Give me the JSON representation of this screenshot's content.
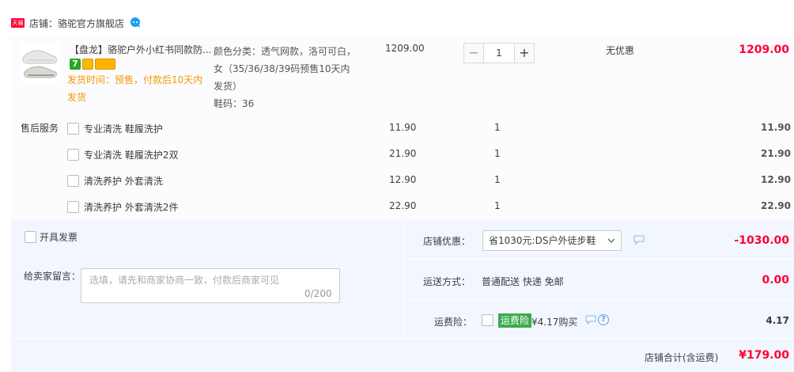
{
  "store": {
    "badge": "天猫",
    "label": "店铺：骆驼官方旗舰店"
  },
  "item": {
    "title": "【盘龙】骆驼户外小红书同款防...",
    "service_icons": [
      "7",
      "bag-icon",
      "card-icon"
    ],
    "ship_note": "发货时间：预售，付款后10天内发货",
    "attrs": [
      "颜色分类：透气网款，洛可可白，",
      "女（35/36/38/39码预售10天内",
      "发货）",
      "鞋码：36"
    ],
    "unit_price": "1209.00",
    "quantity": "1",
    "promotion": "无优惠",
    "total": "1209.00"
  },
  "after_sales": {
    "label": "售后服务",
    "rows": [
      {
        "name": "专业清洗 鞋履洗护",
        "price": "11.90",
        "count": "1",
        "sum": "11.90"
      },
      {
        "name": "专业清洗 鞋履洗护2双",
        "price": "21.90",
        "count": "1",
        "sum": "21.90"
      },
      {
        "name": "清洗养护 外套清洗",
        "price": "12.90",
        "count": "1",
        "sum": "12.90"
      },
      {
        "name": "清洗养护 外套清洗2件",
        "price": "22.90",
        "count": "1",
        "sum": "22.90"
      }
    ]
  },
  "invoice": {
    "label": "开具发票"
  },
  "message": {
    "label": "给卖家留言：",
    "placeholder": "选填，请先和商家协商一致，付款后商家可见",
    "counter": "0/200"
  },
  "shop_discount": {
    "label": "店铺优惠：",
    "selected": "省1030元:DS户外徒步鞋",
    "amount": "-1030.00"
  },
  "shipping": {
    "label": "运送方式：",
    "method": "普通配送 快递 免邮",
    "fee": "0.00"
  },
  "insurance": {
    "label": "运费险：",
    "badge": "运费险",
    "price_text": "¥4.17购买",
    "amount": "4.17"
  },
  "summary": {
    "label": "店铺合计(含运费)",
    "amount": "¥179.00"
  },
  "colors": {
    "price_red": "#ff0036",
    "ship_note_orange": "#f39800",
    "panel_bg": "#f2f7ff",
    "insurance_green": "#3bab4d"
  }
}
